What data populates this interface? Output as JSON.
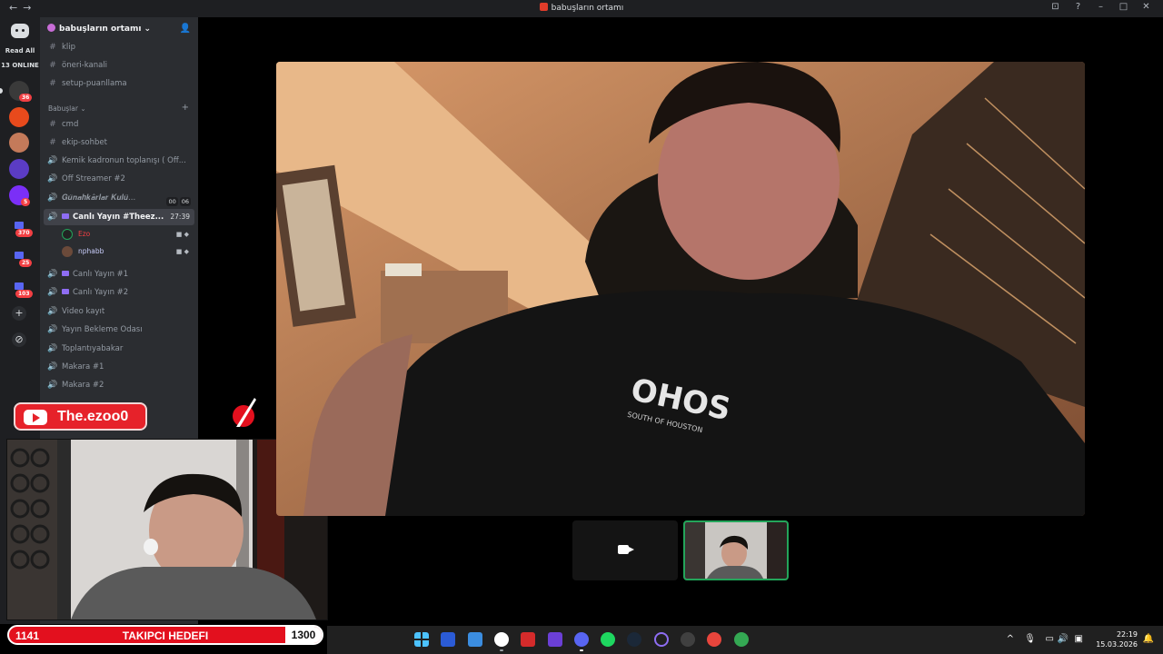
{
  "titlebar": {
    "title": "babuşların ortamı",
    "nav_back": "←",
    "nav_forward": "→",
    "minimize": "–",
    "maximize": "□",
    "close": "✕",
    "help": "?",
    "inbox": "⊡"
  },
  "rail": {
    "read_all": "Read All",
    "online": "13 ONLINE",
    "servers": [
      {
        "name": "ESKIMAIL",
        "badge": "36",
        "color": "#3a3a3a"
      },
      {
        "name": "server-2",
        "badge": "",
        "color": "#e84a1c"
      },
      {
        "name": "server-3",
        "badge": "",
        "color": "#c47a5a"
      },
      {
        "name": "server-4",
        "badge": "",
        "color": "#5b3cc4"
      },
      {
        "name": "SO",
        "badge": "5",
        "color": "#7b2ff7"
      }
    ],
    "folders": [
      {
        "badge": "370"
      },
      {
        "badge": "25"
      },
      {
        "badge": "103"
      }
    ],
    "add_label": "+",
    "discover_label": "⊘"
  },
  "sidebar": {
    "server_name": "babuşların ortamı",
    "top_channels": [
      {
        "type": "text",
        "name": "klip"
      },
      {
        "type": "text",
        "name": "öneri-kanali"
      },
      {
        "type": "text",
        "name": "setup-puanllama"
      }
    ],
    "category": "Babuşlar",
    "channels": [
      {
        "type": "text",
        "name": "cmd"
      },
      {
        "type": "text",
        "name": "ekip-sohbet"
      },
      {
        "type": "voice",
        "name": "Kemik kadronun toplanışı ( Off..."
      },
      {
        "type": "voice",
        "name": "Off Streamer #2"
      },
      {
        "type": "voice",
        "name": "𝑮𝒖̈𝒏𝒂𝒉𝒌𝒂̂𝒓𝒍𝒂𝒓 𝑲𝒖𝒍𝒖̈...",
        "counter_a": "00",
        "counter_b": "06"
      }
    ],
    "active_channel": {
      "name": "Canlı Yayın #Theez...",
      "timer": "27:39"
    },
    "members": [
      {
        "name": "Ezo",
        "color": "#f23f43"
      },
      {
        "name": "nphabb",
        "color": "#c9cdfb"
      }
    ],
    "more_channels": [
      {
        "type": "stream",
        "name": "Canlı Yayın #1"
      },
      {
        "type": "stream",
        "name": "Canlı Yayın #2"
      },
      {
        "type": "voice",
        "name": "Video kayıt"
      },
      {
        "type": "voice",
        "name": "Yayın Bekleme Odası"
      },
      {
        "type": "voice",
        "name": "Toplantıyabakar"
      },
      {
        "type": "voice",
        "name": "Makara #1"
      },
      {
        "type": "voice",
        "name": "Makara #2"
      }
    ]
  },
  "overlay": {
    "youtube_handle": "The.ezoo0",
    "goal_current": "1141",
    "goal_label": "TAKIPCI HEDEFI",
    "goal_target": "1300"
  },
  "tray": {
    "time": "22:19",
    "date": "15.03.2026",
    "chevron": "^",
    "mic": "🎙",
    "wifi": "▭",
    "volume": "🔊",
    "battery": "▣"
  },
  "taskbar_apps": [
    "start",
    "terminal",
    "notepad",
    "obs",
    "voicemeeter",
    "launcher",
    "discord",
    "spotify",
    "steam",
    "app-circle",
    "tools",
    "chrome",
    "chrome-alt"
  ]
}
